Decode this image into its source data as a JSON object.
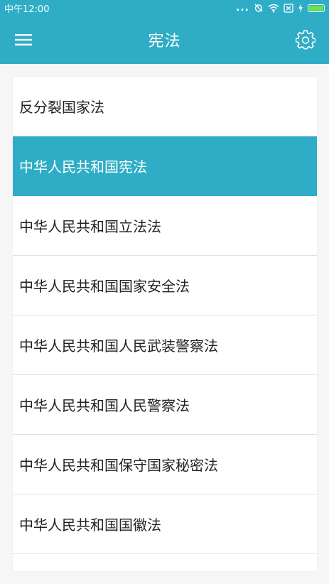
{
  "status_bar": {
    "time": "中午12:00",
    "dots": "...",
    "icons": [
      "alarm-off-icon",
      "wifi-icon",
      "sim-x-icon",
      "charging-icon",
      "battery-icon"
    ],
    "battery_color": "#6ee14b"
  },
  "app_bar": {
    "title": "宪法",
    "menu_icon": "hamburger-menu-icon",
    "settings_icon": "gear-icon",
    "color": "#2fadc6"
  },
  "list": {
    "items": [
      {
        "label": "反分裂国家法",
        "active": false
      },
      {
        "label": "中华人民共和国宪法",
        "active": true
      },
      {
        "label": "中华人民共和国立法法",
        "active": false
      },
      {
        "label": "中华人民共和国国家安全法",
        "active": false
      },
      {
        "label": "中华人民共和国人民武装警察法",
        "active": false
      },
      {
        "label": "中华人民共和国人民警察法",
        "active": false
      },
      {
        "label": "中华人民共和国保守国家秘密法",
        "active": false
      },
      {
        "label": "中华人民共和国国徽法",
        "active": false
      }
    ],
    "active_color": "#2fadc6"
  }
}
